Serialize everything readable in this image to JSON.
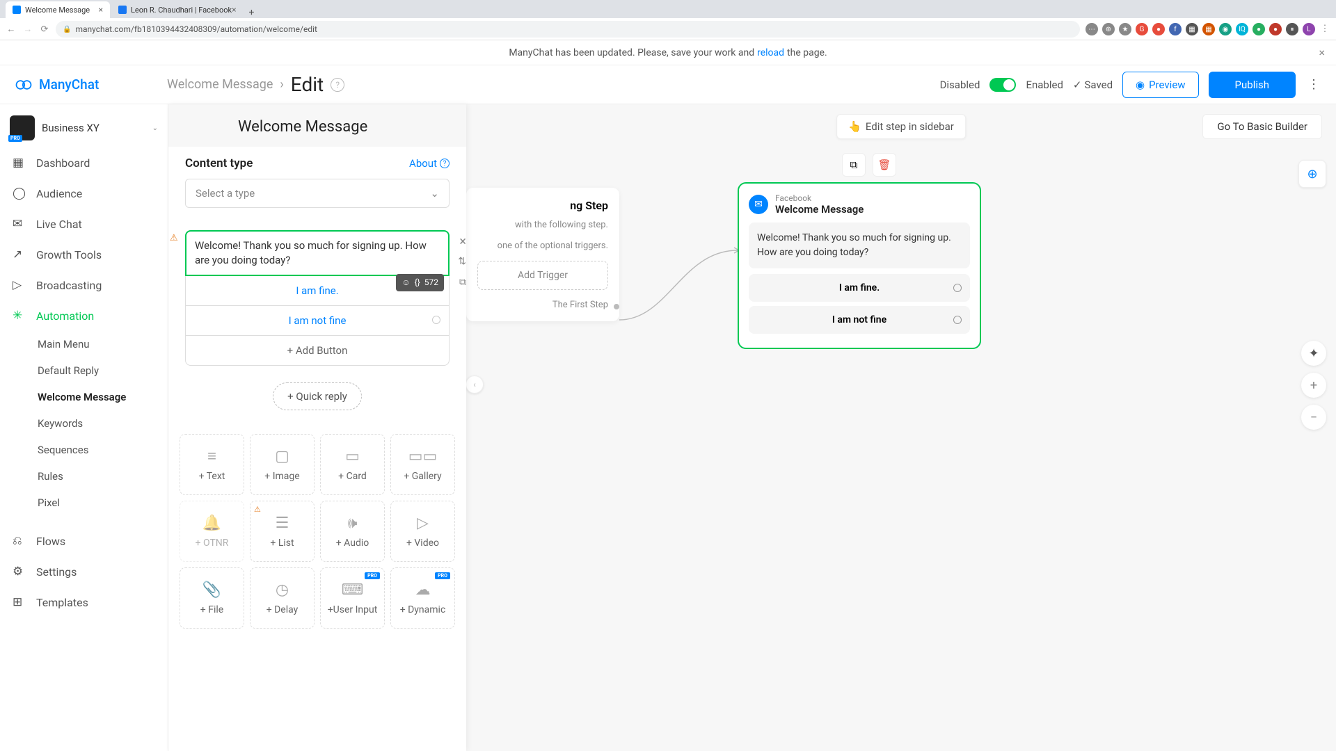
{
  "browser": {
    "tabs": [
      {
        "title": "Welcome Message",
        "active": true
      },
      {
        "title": "Leon R. Chaudhari | Facebook",
        "active": false
      }
    ],
    "url": "manychat.com/fb181039443240830​9/automation/welcome/edit"
  },
  "banner": {
    "text_before": "ManyChat has been updated. Please, save your work and",
    "link": "reload",
    "text_after": "the page."
  },
  "brand": "ManyChat",
  "header": {
    "breadcrumb_root": "Welcome Message",
    "breadcrumb_current": "Edit",
    "disabled_label": "Disabled",
    "enabled_label": "Enabled",
    "saved_label": "Saved",
    "preview_label": "Preview",
    "publish_label": "Publish"
  },
  "workspace": {
    "name": "Business XY",
    "badge": "PRO"
  },
  "nav": {
    "items": [
      {
        "label": "Dashboard",
        "icon": "▦"
      },
      {
        "label": "Audience",
        "icon": "◯"
      },
      {
        "label": "Live Chat",
        "icon": "✉"
      },
      {
        "label": "Growth Tools",
        "icon": "↗"
      },
      {
        "label": "Broadcasting",
        "icon": "▷"
      },
      {
        "label": "Automation",
        "icon": "✳",
        "active": true
      }
    ],
    "automation_sub": [
      {
        "label": "Main Menu"
      },
      {
        "label": "Default Reply"
      },
      {
        "label": "Welcome Message",
        "active": true
      },
      {
        "label": "Keywords"
      },
      {
        "label": "Sequences"
      },
      {
        "label": "Rules"
      },
      {
        "label": "Pixel"
      }
    ],
    "bottom": [
      {
        "label": "Flows",
        "icon": "⎌"
      },
      {
        "label": "Settings",
        "icon": "⚙"
      },
      {
        "label": "Templates",
        "icon": "⊞"
      }
    ]
  },
  "panel": {
    "title": "Welcome Message",
    "content_type_label": "Content type",
    "about_label": "About",
    "select_placeholder": "Select a type",
    "message_text": "Welcome! Thank you so much for signing up. How are you doing today?",
    "char_remaining": "572",
    "buttons": [
      "I am fine.",
      "I am not fine"
    ],
    "add_button_label": "+ Add Button",
    "quick_reply_label": "+ Quick reply",
    "blocks": [
      {
        "label": "+ Text",
        "icon": "≡"
      },
      {
        "label": "+ Image",
        "icon": "▢"
      },
      {
        "label": "+ Card",
        "icon": "▭"
      },
      {
        "label": "+ Gallery",
        "icon": "▭▭"
      },
      {
        "label": "+ OTNR",
        "icon": "🔔",
        "disabled": true
      },
      {
        "label": "+ List",
        "icon": "☰",
        "warn": true
      },
      {
        "label": "+ Audio",
        "icon": "🕪"
      },
      {
        "label": "+ Video",
        "icon": "▷"
      },
      {
        "label": "+ File",
        "icon": "📎"
      },
      {
        "label": "+ Delay",
        "icon": "◷"
      },
      {
        "label": "+User Input",
        "icon": "⌨",
        "pro": true
      },
      {
        "label": "+ Dynamic",
        "icon": "☁",
        "pro": true
      }
    ]
  },
  "canvas": {
    "edit_sidebar": "Edit step in sidebar",
    "basic_builder": "Go To Basic Builder",
    "start_node": {
      "title": "ng Step",
      "desc1": "with the following step.",
      "desc2": "one of the optional triggers.",
      "add_trigger": "Add Trigger",
      "first_step": "The First Step"
    },
    "msg_node": {
      "platform": "Facebook",
      "title": "Welcome Message",
      "body": "Welcome! Thank you so much for signing up. How are you doing today?",
      "buttons": [
        "I am fine.",
        "I am not fine"
      ]
    }
  }
}
